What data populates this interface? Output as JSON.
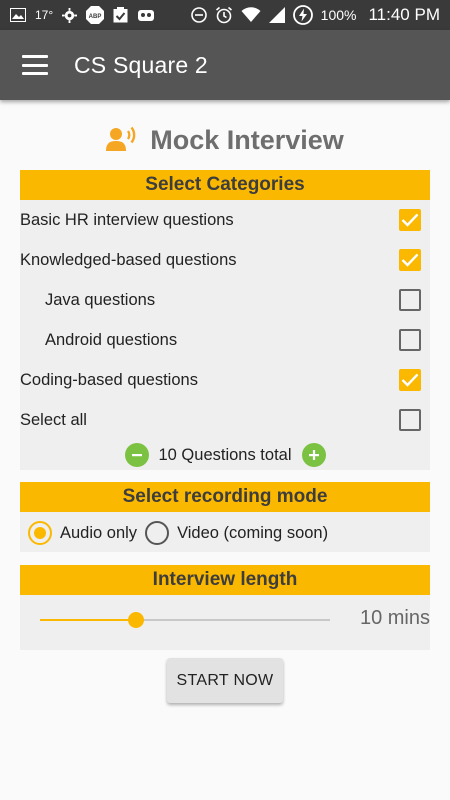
{
  "status_bar": {
    "temperature": "17°",
    "abp_label": "ABP",
    "battery_percent": "100%",
    "time": "11:40 PM"
  },
  "app_bar": {
    "title": "CS Square 2"
  },
  "page": {
    "title": "Mock Interview"
  },
  "categories": {
    "header": "Select Categories",
    "items": [
      {
        "label": "Basic HR interview questions",
        "checked": true,
        "indent": false
      },
      {
        "label": "Knowledged-based questions",
        "checked": true,
        "indent": false
      },
      {
        "label": "Java questions",
        "checked": false,
        "indent": true
      },
      {
        "label": "Android questions",
        "checked": false,
        "indent": true
      },
      {
        "label": "Coding-based questions",
        "checked": true,
        "indent": false
      },
      {
        "label": "Select all",
        "checked": false,
        "indent": false
      }
    ],
    "questions_total": "10 Questions total"
  },
  "recording": {
    "header": "Select recording mode",
    "options": [
      {
        "label": "Audio only",
        "selected": true
      },
      {
        "label": "Video (coming soon)",
        "selected": false
      }
    ]
  },
  "length": {
    "header": "Interview length",
    "slider_fraction": 0.33,
    "value_label": "10 mins"
  },
  "actions": {
    "start_label": "START NOW"
  },
  "colors": {
    "accent": "#fbb800",
    "app_bar": "#555555",
    "status_bar": "#3a3a3a",
    "counter_buttons": "#7cc242"
  }
}
